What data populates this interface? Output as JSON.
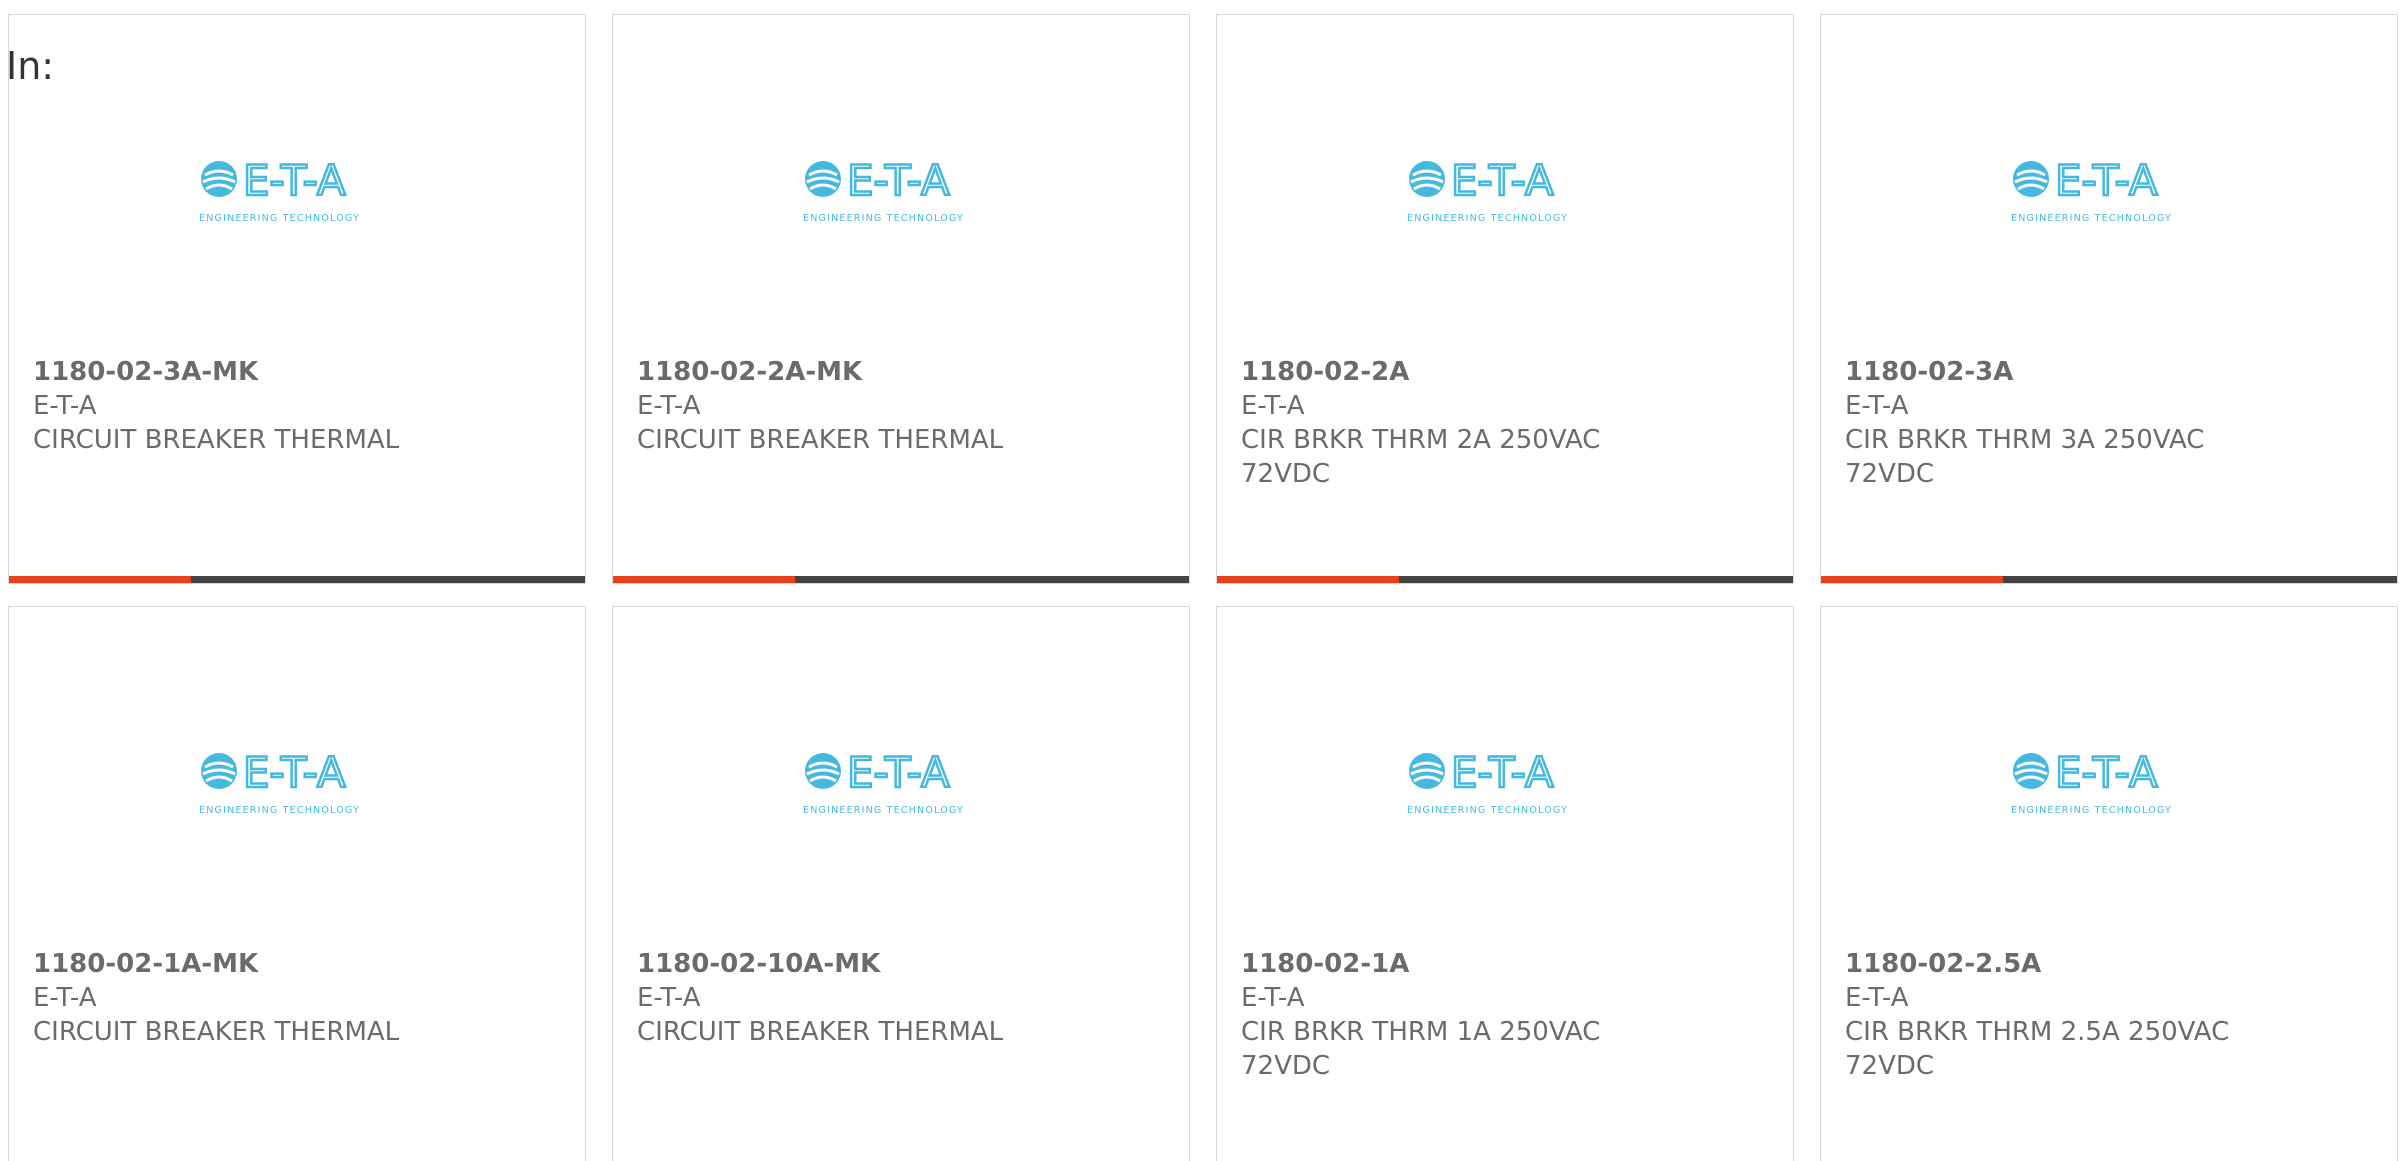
{
  "filter_label": "In:",
  "colors": {
    "accent": "#e8421c",
    "bar": "#444444",
    "logo": "#45b8e0",
    "text": "#6b6b6b",
    "border": "#d6d6d6"
  },
  "logo": {
    "mark": "E-T-A",
    "tagline": "ENGINEERING TECHNOLOGY",
    "icon": "eta-logo-icon"
  },
  "products": [
    {
      "part": "1180-02-3A-MK",
      "maker": "E-T-A",
      "desc": "CIRCUIT BREAKER THERMAL"
    },
    {
      "part": "1180-02-2A-MK",
      "maker": "E-T-A",
      "desc": "CIRCUIT BREAKER THERMAL"
    },
    {
      "part": "1180-02-2A",
      "maker": "E-T-A",
      "desc": "CIR BRKR THRM 2A 250VAC 72VDC"
    },
    {
      "part": "1180-02-3A",
      "maker": "E-T-A",
      "desc": "CIR BRKR THRM 3A 250VAC 72VDC"
    },
    {
      "part": "1180-02-1A-MK",
      "maker": "E-T-A",
      "desc": "CIRCUIT BREAKER THERMAL"
    },
    {
      "part": "1180-02-10A-MK",
      "maker": "E-T-A",
      "desc": "CIRCUIT BREAKER THERMAL"
    },
    {
      "part": "1180-02-1A",
      "maker": "E-T-A",
      "desc": "CIR BRKR THRM 1A 250VAC 72VDC"
    },
    {
      "part": "1180-02-2.5A",
      "maker": "E-T-A",
      "desc": "CIR BRKR THRM 2.5A 250VAC 72VDC"
    }
  ]
}
